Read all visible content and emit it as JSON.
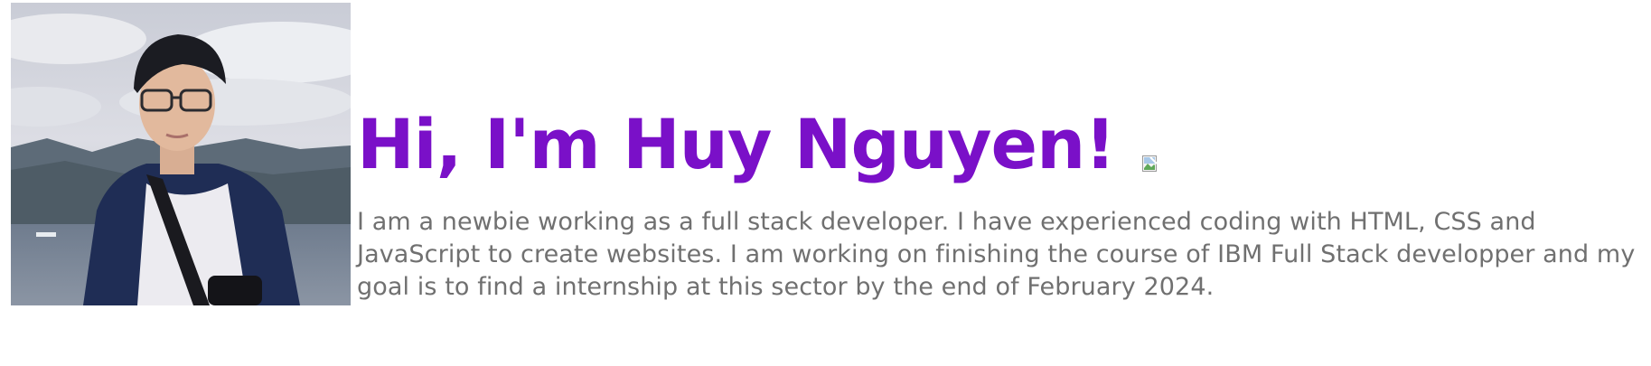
{
  "profile": {
    "photo_alt": "portrait photo",
    "greeting": "Hi, I'm Huy Nguyen!",
    "wave_image_alt": "",
    "bio": "I am a newbie working as a full stack developer. I have experienced coding with HTML, CSS and JavaScript to create websites. I am working on finishing the course of IBM Full Stack developper and my goal is to find a internship at this sector by the end of February 2024."
  },
  "colors": {
    "heading": "#7a10c8",
    "body_text": "#707070",
    "background": "#ffffff"
  }
}
